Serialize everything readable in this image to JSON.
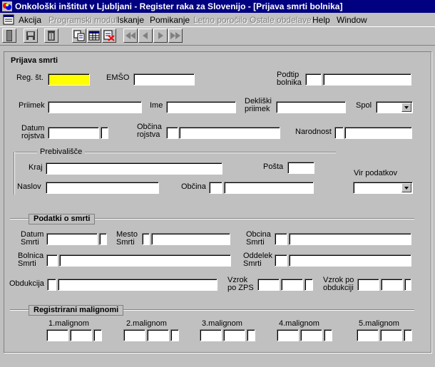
{
  "window": {
    "title": "Onkološki inštitut v Ljubljani - Register raka za Slovenijo - [Prijava smrti bolnika]"
  },
  "menu": [
    {
      "label": "Akcija",
      "enabled": true
    },
    {
      "label": "Programski moduli",
      "enabled": false
    },
    {
      "label": "Iskanje",
      "enabled": true
    },
    {
      "label": "Pomikanje",
      "enabled": true
    },
    {
      "label": "Letno poročilo",
      "enabled": false
    },
    {
      "label": "Ostale obdelave",
      "enabled": false
    },
    {
      "label": "Help",
      "enabled": true
    },
    {
      "label": "Window",
      "enabled": true
    }
  ],
  "toolbar": {
    "icons": [
      "door-icon",
      "save-icon",
      "delete-icon",
      "copy-icon",
      "table-icon",
      "cancel-icon",
      "first-record-icon",
      "previous-record-icon",
      "next-record-icon",
      "last-record-icon"
    ]
  },
  "form": {
    "section_title": "Prijava smrti",
    "reg_st_label": "Reg. št.",
    "emso_label": "EMŠO",
    "podtip_label": "Podtip\nbolnika",
    "priimek_label": "Priimek",
    "ime_label": "Ime",
    "dekliski_label": "Dekliški\npriimek",
    "spol_label": "Spol",
    "datum_rojstva_label": "Datum\nrojstva",
    "obcina_rojstva_label": "Občina\nrojstva",
    "narodnost_label": "Narodnost",
    "prebivalisce": {
      "title": "Prebivališče",
      "kraj_label": "Kraj",
      "posta_label": "Pošta",
      "naslov_label": "Naslov",
      "obcina_label": "Občina"
    },
    "vir_podatkov_label": "Vir podatkov",
    "smrt": {
      "title": "Podatki o smrti",
      "datum_label": "Datum\nSmrti",
      "mesto_label": "Mesto\nSmrti",
      "obcina_label": "Obcina\nSmrti",
      "bolnica_label": "Bolnica\nSmrti",
      "oddelek_label": "Oddelek\nSmrti",
      "obdukcija_label": "Obdukcija",
      "vzrok_zps_label": "Vzrok\npo ZPS",
      "vzrok_obdukciji_label": "Vzrok po\nobdukciji"
    },
    "malignomi": {
      "title": "Registrirani malignomi",
      "labels": [
        "1.malignom",
        "2.malignom",
        "3.malignom",
        "4.malignom",
        "5.malignom"
      ]
    }
  },
  "colors": {
    "titlebar": "#000080",
    "highlight_field": "#ffff00",
    "face": "#c0c0c0"
  }
}
